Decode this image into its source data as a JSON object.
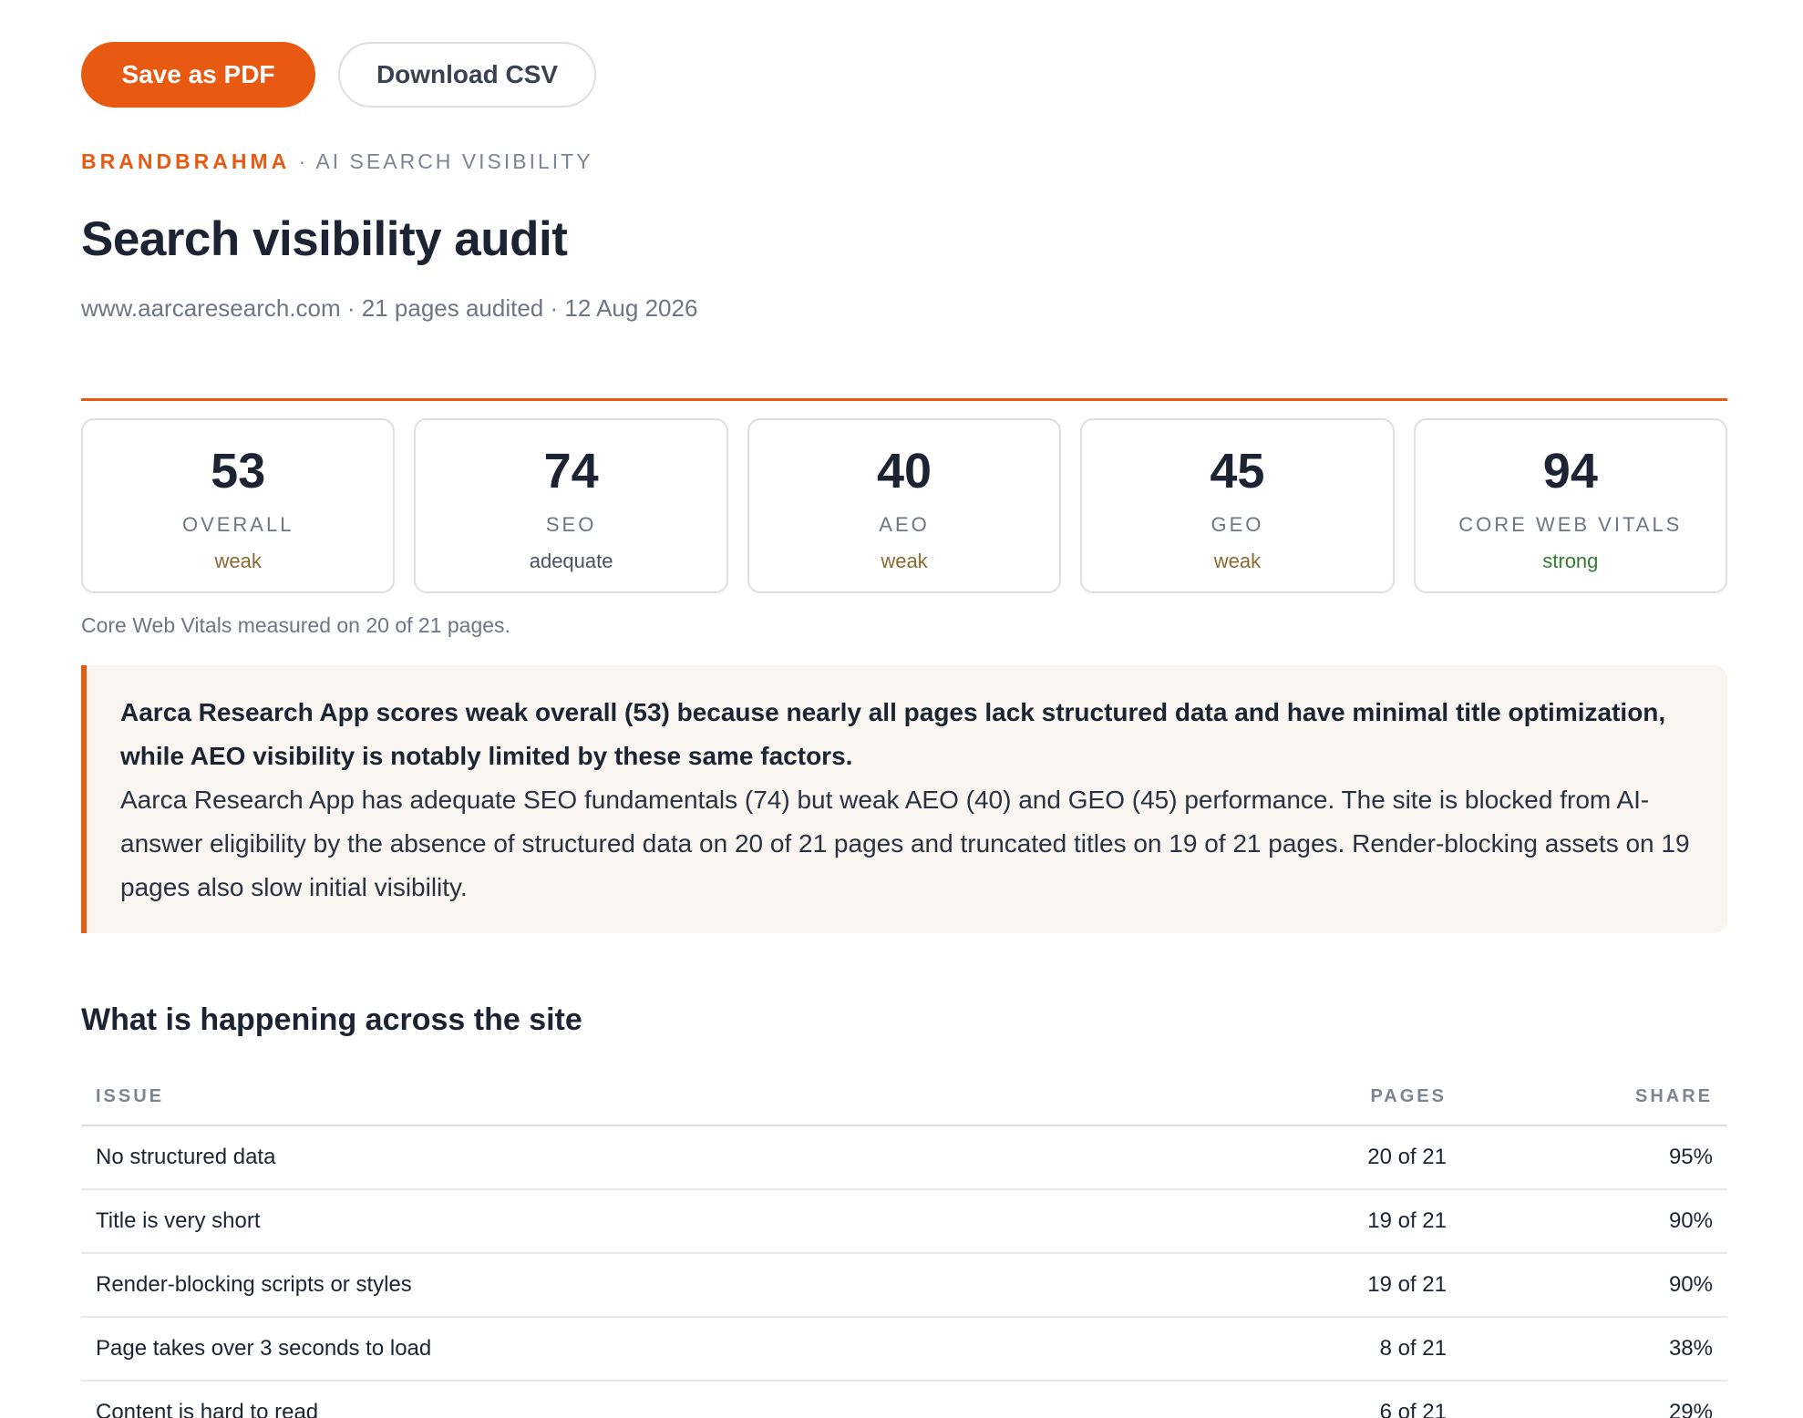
{
  "toolbar": {
    "save_pdf_label": "Save as PDF",
    "download_csv_label": "Download CSV"
  },
  "header": {
    "brand": "BRANDBRAHMA",
    "separator": " · ",
    "product": "AI SEARCH VISIBILITY",
    "title": "Search visibility audit",
    "meta": "www.aarcaresearch.com · 21 pages audited · 12 Aug 2026"
  },
  "scores": [
    {
      "value": "53",
      "label": "OVERALL",
      "rating": "weak"
    },
    {
      "value": "74",
      "label": "SEO",
      "rating": "adequate"
    },
    {
      "value": "40",
      "label": "AEO",
      "rating": "weak"
    },
    {
      "value": "45",
      "label": "GEO",
      "rating": "weak"
    },
    {
      "value": "94",
      "label": "CORE WEB VITALS",
      "rating": "strong"
    }
  ],
  "cwv_note": "Core Web Vitals measured on 20 of 21 pages.",
  "summary": {
    "headline": "Aarca Research App scores weak overall (53) because nearly all pages lack structured data and have minimal title optimization, while AEO visibility is notably limited by these same factors.",
    "body": "Aarca Research App has adequate SEO fundamentals (74) but weak AEO (40) and GEO (45) performance. The site is blocked from AI-answer eligibility by the absence of structured data on 20 of 21 pages and truncated titles on 19 of 21 pages. Render-blocking assets on 19 pages also slow initial visibility."
  },
  "issues_section": {
    "title": "What is happening across the site",
    "columns": {
      "issue": "ISSUE",
      "pages": "PAGES",
      "share": "SHARE"
    },
    "rows": [
      {
        "issue": "No structured data",
        "pages": "20 of 21",
        "share": "95%"
      },
      {
        "issue": "Title is very short",
        "pages": "19 of 21",
        "share": "90%"
      },
      {
        "issue": "Render-blocking scripts or styles",
        "pages": "19 of 21",
        "share": "90%"
      },
      {
        "issue": "Page takes over 3 seconds to load",
        "pages": "8 of 21",
        "share": "38%"
      },
      {
        "issue": "Content is hard to read",
        "pages": "6 of 21",
        "share": "29%"
      }
    ]
  },
  "colors": {
    "accent": "#e85a12",
    "rating_weak": "#8a6a30",
    "rating_strong": "#2f7d32",
    "summary_bg": "#f9f6f1"
  }
}
